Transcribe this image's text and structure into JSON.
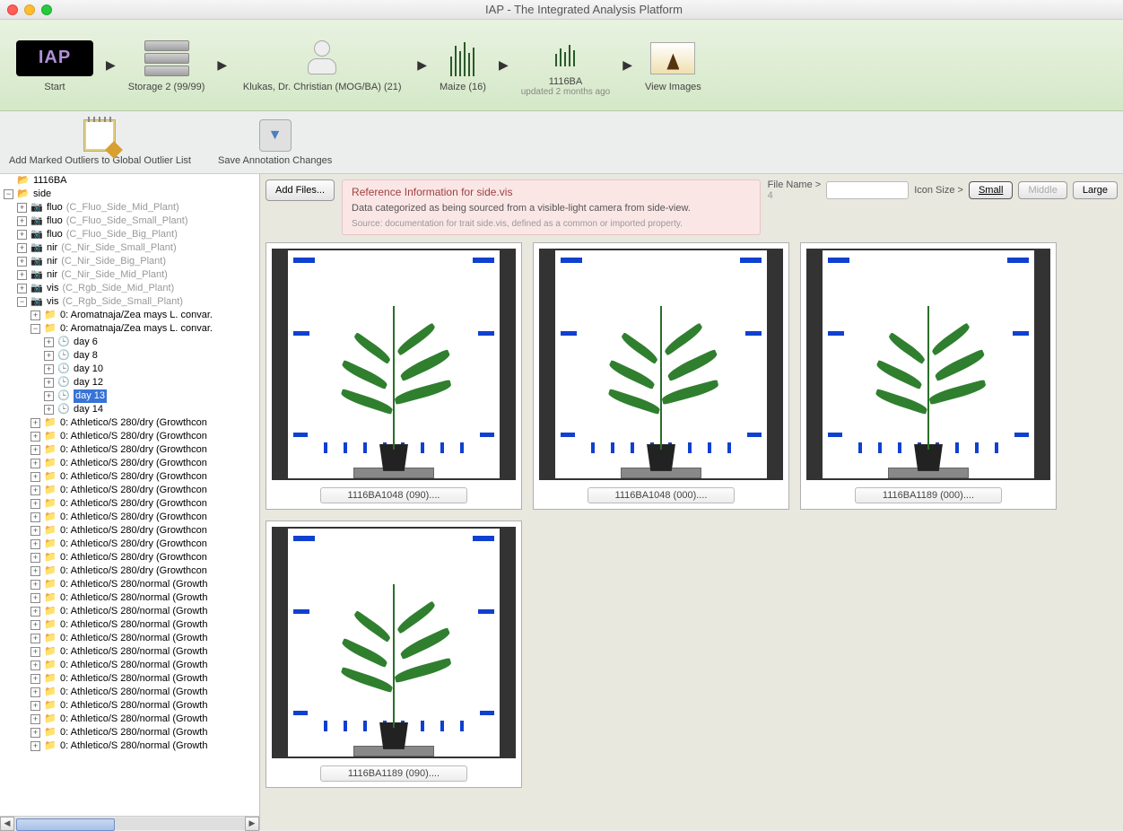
{
  "window": {
    "title": "IAP - The Integrated Analysis Platform"
  },
  "breadcrumb": [
    {
      "label": "Start",
      "sub": "",
      "icon": "iap"
    },
    {
      "label": "Storage 2 (99/99)",
      "sub": "",
      "icon": "storage"
    },
    {
      "label": "Klukas, Dr. Christian (MOG/BA) (21)",
      "sub": "",
      "icon": "person"
    },
    {
      "label": "Maize (16)",
      "sub": "",
      "icon": "plants"
    },
    {
      "label": "1116BA",
      "sub": "updated 2 months ago",
      "icon": "plants-small"
    },
    {
      "label": "View Images",
      "sub": "",
      "icon": "photo"
    }
  ],
  "toolbar": {
    "outliers": "Add Marked Outliers to Global Outlier List",
    "save": "Save Annotation Changes"
  },
  "tree": {
    "root": "1116BA",
    "side": "side",
    "cameras": [
      {
        "name": "fluo",
        "detail": "(C_Fluo_Side_Mid_Plant)",
        "expanded": false
      },
      {
        "name": "fluo",
        "detail": "(C_Fluo_Side_Small_Plant)",
        "expanded": false
      },
      {
        "name": "fluo",
        "detail": "(C_Fluo_Side_Big_Plant)",
        "expanded": false
      },
      {
        "name": "nir",
        "detail": "(C_Nir_Side_Small_Plant)",
        "expanded": false
      },
      {
        "name": "nir",
        "detail": "(C_Nir_Side_Big_Plant)",
        "expanded": false
      },
      {
        "name": "nir",
        "detail": "(C_Nir_Side_Mid_Plant)",
        "expanded": false
      },
      {
        "name": "vis",
        "detail": "(C_Rgb_Side_Mid_Plant)",
        "expanded": false
      },
      {
        "name": "vis",
        "detail": "(C_Rgb_Side_Small_Plant)",
        "expanded": true
      }
    ],
    "aromatnaja": [
      {
        "label": "0: Aromatnaja/Zea mays L. convar.",
        "expanded": false
      },
      {
        "label": "0: Aromatnaja/Zea mays L. convar.",
        "expanded": true
      }
    ],
    "days": [
      {
        "label": "day 6",
        "selected": false
      },
      {
        "label": "day 8",
        "selected": false
      },
      {
        "label": "day 10",
        "selected": false
      },
      {
        "label": "day 12",
        "selected": false
      },
      {
        "label": "day 13",
        "selected": true
      },
      {
        "label": "day 14",
        "selected": false
      }
    ],
    "athletico": [
      "0: Athletico/S 280/dry (Growthcon",
      "0: Athletico/S 280/dry (Growthcon",
      "0: Athletico/S 280/dry (Growthcon",
      "0: Athletico/S 280/dry (Growthcon",
      "0: Athletico/S 280/dry (Growthcon",
      "0: Athletico/S 280/dry (Growthcon",
      "0: Athletico/S 280/dry (Growthcon",
      "0: Athletico/S 280/dry (Growthcon",
      "0: Athletico/S 280/dry (Growthcon",
      "0: Athletico/S 280/dry (Growthcon",
      "0: Athletico/S 280/dry (Growthcon",
      "0: Athletico/S 280/dry (Growthcon",
      "0: Athletico/S 280/normal (Growth",
      "0: Athletico/S 280/normal (Growth",
      "0: Athletico/S 280/normal (Growth",
      "0: Athletico/S 280/normal (Growth",
      "0: Athletico/S 280/normal (Growth",
      "0: Athletico/S 280/normal (Growth",
      "0: Athletico/S 280/normal (Growth",
      "0: Athletico/S 280/normal (Growth",
      "0: Athletico/S 280/normal (Growth",
      "0: Athletico/S 280/normal (Growth",
      "0: Athletico/S 280/normal (Growth",
      "0: Athletico/S 280/normal (Growth",
      "0: Athletico/S 280/normal (Growth"
    ]
  },
  "content": {
    "add_files": "Add Files...",
    "info_title": "Reference Information for side.vis",
    "info_body": "Data categorized as being sourced from a visible-light camera from side-view.",
    "info_source": "Source: documentation for trait side.vis, defined as a common or imported property.",
    "file_name_label": "File Name >",
    "file_name_value": "",
    "file_count": "4",
    "icon_size_label": "Icon Size >",
    "size_small": "Small",
    "size_middle": "Middle",
    "size_large": "Large",
    "thumbs": [
      "1116BA1048 (090)....",
      "1116BA1048 (000)....",
      "1116BA1189 (000)....",
      "1116BA1189 (090)...."
    ]
  }
}
